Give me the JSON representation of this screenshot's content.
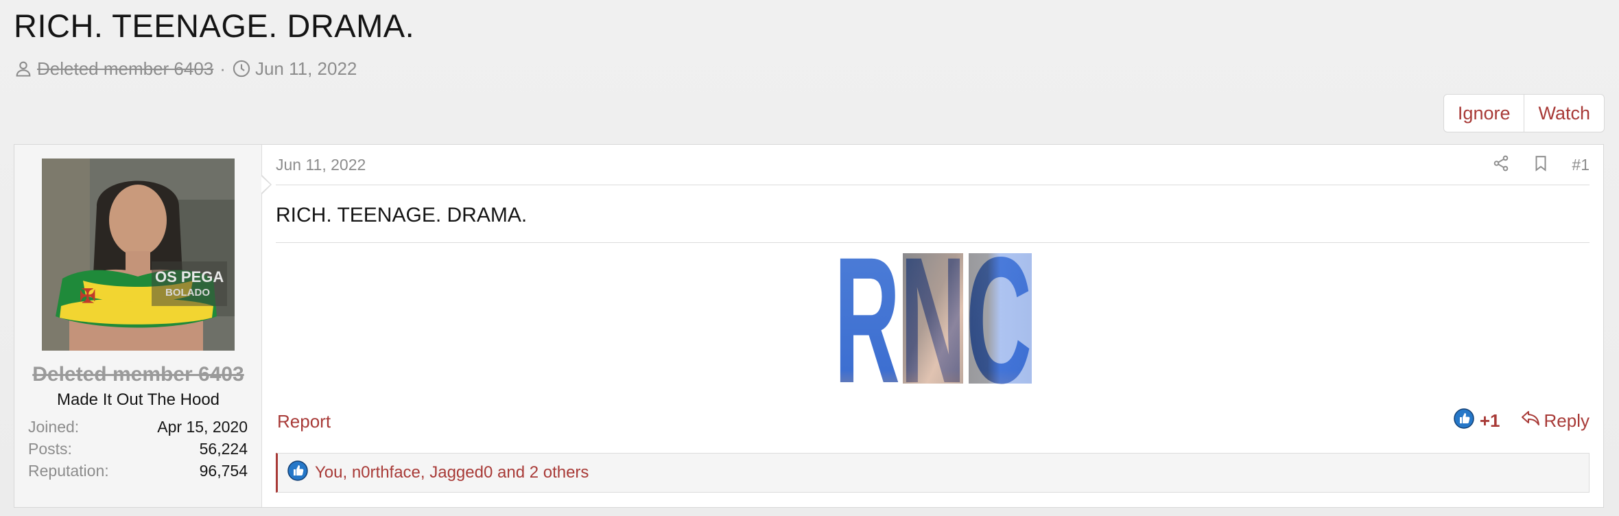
{
  "thread": {
    "title": "RICH. TEENAGE. DRAMA.",
    "author": "Deleted member 6403",
    "separator": "·",
    "date": "Jun 11, 2022"
  },
  "actions": {
    "ignore": "Ignore",
    "watch": "Watch"
  },
  "user": {
    "name": "Deleted member 6403",
    "title": "Made It Out The Hood",
    "avatar_caption_line1": "OS PEGA",
    "avatar_caption_line2": "BOLADO",
    "stats": [
      {
        "label": "Joined:",
        "value": "Apr 15, 2020"
      },
      {
        "label": "Posts:",
        "value": "56,224"
      },
      {
        "label": "Reputation:",
        "value": "96,754"
      }
    ]
  },
  "post": {
    "date": "Jun 11, 2022",
    "number": "#1",
    "body_title": "RICH. TEENAGE. DRAMA.",
    "image_letters": "RNC",
    "report_label": "Report",
    "reaction_count": "+1",
    "reply_label": "Reply",
    "reactions_summary": "You, n0rthface, Jagged0 and 2 others"
  },
  "colors": {
    "link": "#a83a37",
    "muted": "#8c8c8c",
    "like_blue": "#2577c8",
    "image_blue": "#3d6fd1"
  }
}
